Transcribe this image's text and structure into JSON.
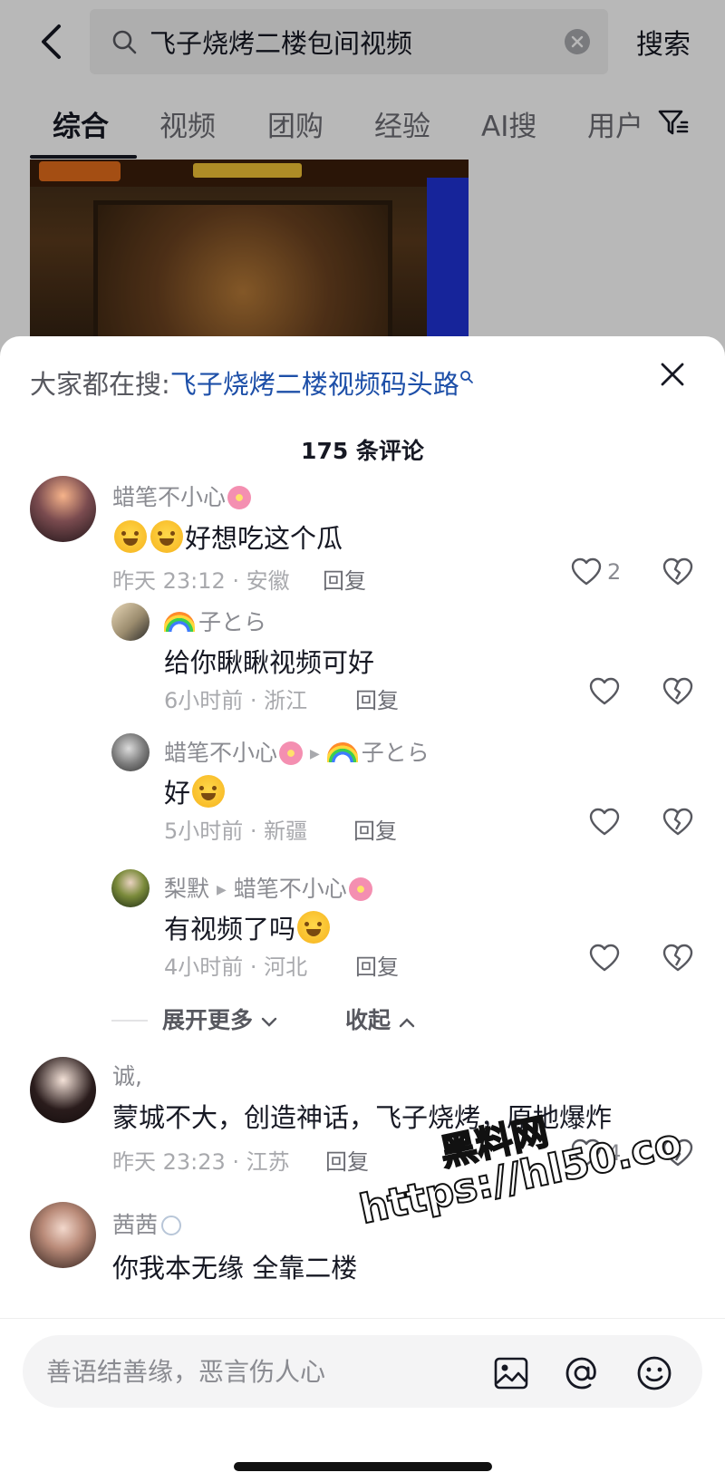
{
  "search": {
    "back_icon": "chevron-left-icon",
    "query": "飞子烧烤二楼包间视频",
    "clear_icon": "clear-icon",
    "action_label": "搜索"
  },
  "tabs": [
    {
      "label": "综合",
      "active": true
    },
    {
      "label": "视频"
    },
    {
      "label": "团购"
    },
    {
      "label": "经验"
    },
    {
      "label": "AI搜"
    },
    {
      "label": "用户"
    }
  ],
  "filter_icon": "filter-icon",
  "sheet": {
    "hot_search_prefix": "大家都在搜:",
    "hot_search_link": "飞子烧烤二楼视频码头路",
    "close_icon": "close-icon",
    "comment_count": "175 条评论"
  },
  "comments": [
    {
      "author": "蜡笔不小心",
      "text": "好想吃这个瓜",
      "time_location": "昨天 23:12 · 安徽",
      "reply_label": "回复",
      "likes": "2",
      "replies": [
        {
          "author": "子とら",
          "text": "给你瞅瞅视频可好",
          "time_location": "6小时前 · 浙江",
          "reply_label": "回复"
        },
        {
          "author": "蜡笔不小心",
          "reply_to": "子とら",
          "text": "好",
          "time_location": "5小时前 · 新疆",
          "reply_label": "回复"
        },
        {
          "author": "梨默",
          "reply_to": "蜡笔不小心",
          "text": "有视频了吗",
          "time_location": "4小时前 · 河北",
          "reply_label": "回复"
        }
      ]
    },
    {
      "author": "诚,",
      "text": "蒙城不大，创造神话，飞子烧烤，原地爆炸",
      "time_location": "昨天 23:23 · 江苏",
      "reply_label": "回复",
      "likes": "4"
    },
    {
      "author": "茜茜",
      "text": "你我本无缘 全靠二楼"
    }
  ],
  "expand": {
    "more_label": "展开更多",
    "collapse_label": "收起"
  },
  "watermark": {
    "title": "黑料网",
    "url": "https://hl50.co"
  },
  "composer": {
    "placeholder": "善语结善缘，恶言伤人心",
    "icons": [
      "image-icon",
      "at-icon",
      "emoji-icon"
    ]
  },
  "colors": {
    "link": "#1d4fa8",
    "text": "#161823",
    "secondary": "#8a8b91"
  }
}
